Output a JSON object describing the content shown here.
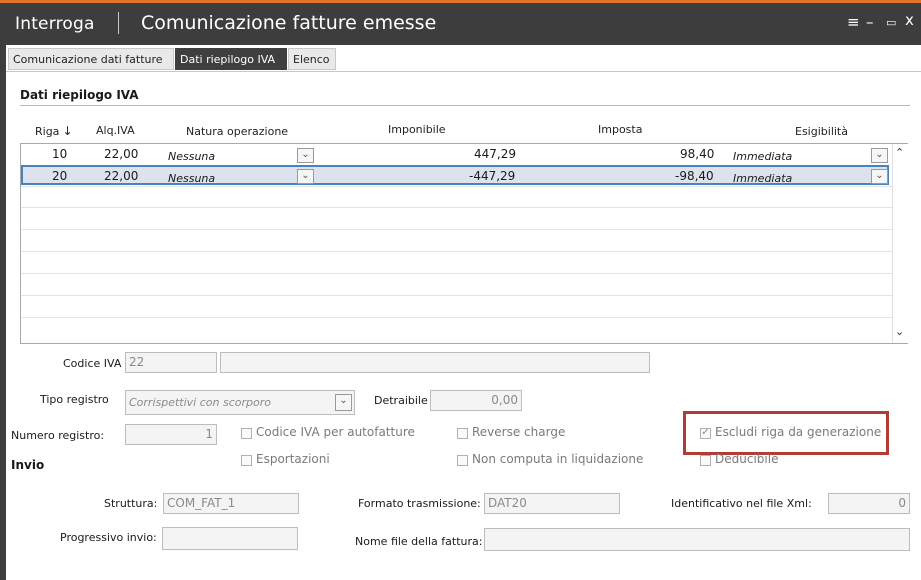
{
  "window": {
    "section": "Interroga",
    "title": "Comunicazione fatture emesse",
    "controls": [
      "≡",
      "–",
      "▭",
      "x"
    ]
  },
  "tabs": [
    {
      "label": "Comunicazione dati fatture",
      "active": false
    },
    {
      "label": "Dati riepilogo IVA",
      "active": true
    },
    {
      "label": "Elenco",
      "active": false
    }
  ],
  "section_title": "Dati riepilogo IVA",
  "grid": {
    "columns": [
      "Riga",
      "Alq.IVA",
      "Natura operazione",
      "Imponibile",
      "Imposta",
      "Esigibilità"
    ],
    "rows": [
      {
        "riga": "10",
        "aliquota": "22,00",
        "natura": "Nessuna",
        "imponibile": "447,29",
        "imposta": "98,40",
        "esigibilita": "Immediata"
      },
      {
        "riga": "20",
        "aliquota": "22,00",
        "natura": "Nessuna",
        "imponibile": "-447,29",
        "imposta": "-98,40",
        "esigibilita": "Immediata"
      }
    ]
  },
  "form": {
    "codice_iva_label": "Codice IVA",
    "codice_iva_value": "22",
    "codice_iva_desc": "",
    "tipo_registro_label": "Tipo registro",
    "tipo_registro_value": "Corrispettivi con scorporo",
    "detraibile_label": "Detraibile",
    "detraibile_value": "0,00",
    "numero_registro_label": "Numero registro:",
    "numero_registro_value": "1",
    "checkboxes": {
      "codice_iva_autofatture": {
        "label": "Codice IVA per autofatture",
        "checked": false
      },
      "reverse_charge": {
        "label": "Reverse charge",
        "checked": false
      },
      "escludi_riga": {
        "label": "Escludi riga da generazione",
        "checked": true
      },
      "esportazioni": {
        "label": "Esportazioni",
        "checked": false
      },
      "non_computa": {
        "label": "Non computa in liquidazione",
        "checked": false
      },
      "deducibile": {
        "label": "Deducibile",
        "checked": false
      }
    }
  },
  "invio": {
    "title": "Invio",
    "struttura_label": "Struttura:",
    "struttura_value": "COM_FAT_1",
    "formato_label": "Formato trasmissione:",
    "formato_value": "DAT20",
    "identificativo_label": "Identificativo nel file Xml:",
    "identificativo_value": "0",
    "progressivo_label": "Progressivo invio:",
    "progressivo_value": "",
    "nome_file_label": "Nome file della fattura:",
    "nome_file_value": ""
  },
  "colors": {
    "accent": "#e1742a",
    "titlebar": "#3d3d3d",
    "selection_border": "#4a7fc0",
    "highlight_box": "#b23b35"
  }
}
